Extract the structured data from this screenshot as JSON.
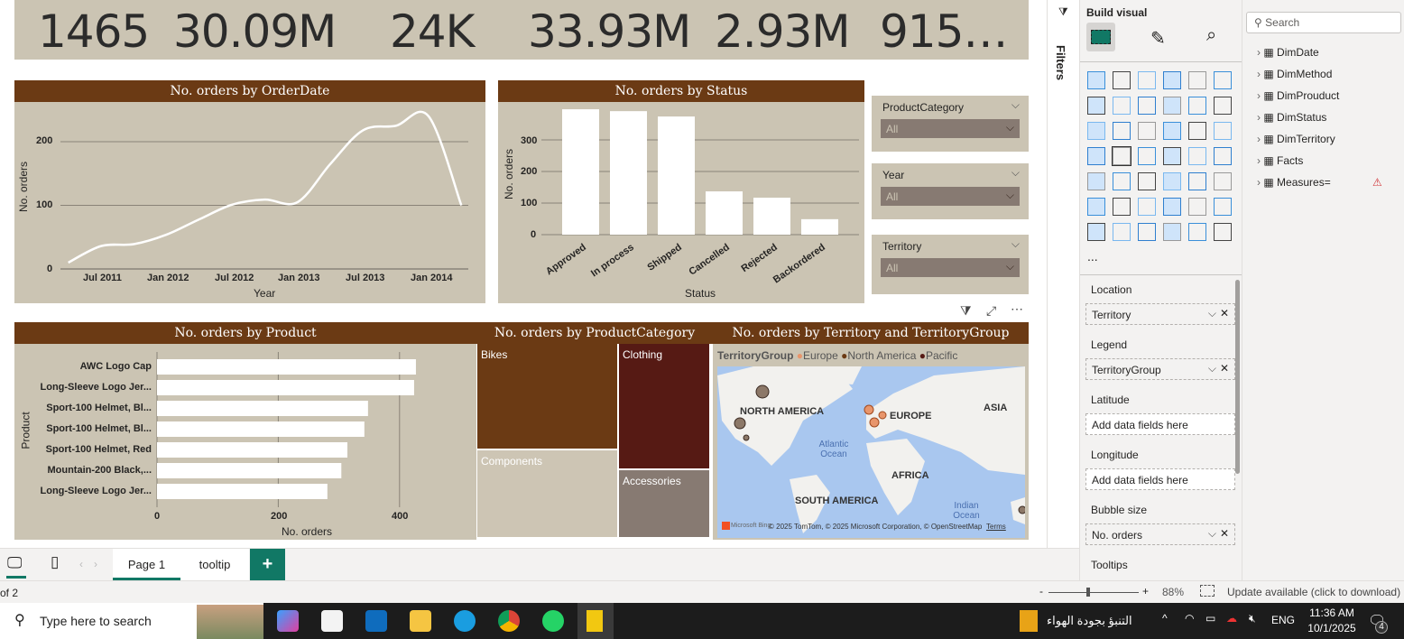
{
  "kpis": [
    "1465",
    "30.09M",
    "24K",
    "33.93M",
    "2.93M",
    "915…"
  ],
  "colors": {
    "header": "#6b3a14",
    "panel": "#cbc4b3",
    "bikes": "#6b3a14",
    "clothing": "#561a14",
    "components": "#cdc5b4",
    "accessories": "#877a72",
    "europe": "#e8956b",
    "north_america": "#6b3a14",
    "pacific": "#561a14",
    "accent": "#117865"
  },
  "line_chart": {
    "title": "No. orders by OrderDate",
    "xlabel": "Year",
    "ylabel": "No. orders",
    "yticks": [
      "0",
      "100",
      "200"
    ],
    "xticks": [
      "Jul 2011",
      "Jan 2012",
      "Jul 2012",
      "Jan 2013",
      "Jul 2013",
      "Jan 2014"
    ]
  },
  "status_chart": {
    "title": "No. orders by Status",
    "xlabel": "Status",
    "ylabel": "No. orders",
    "yticks": [
      "0",
      "100",
      "200",
      "300"
    ]
  },
  "product_chart": {
    "title": "No. orders by Product",
    "xlabel": "No. orders",
    "ylabel": "Product",
    "xticks": [
      "0",
      "200",
      "400"
    ]
  },
  "treemap": {
    "title": "No. orders by ProductCategory",
    "items": [
      "Bikes",
      "Clothing",
      "Components",
      "Accessories"
    ]
  },
  "map": {
    "title": "No. orders by Territory and TerritoryGroup",
    "legend_title": "TerritoryGroup",
    "legend": [
      "Europe",
      "North America",
      "Pacific"
    ],
    "labels": [
      "NORTH AMERICA",
      "EUROPE",
      "ASIA",
      "AFRICA",
      "SOUTH AMERICA",
      "Atlantic Ocean",
      "Indian Ocean"
    ],
    "attribution": "© 2025 TomTom, © 2025 Microsoft Corporation, © OpenStreetMap",
    "terms": "Terms",
    "bing": "Microsoft Bing"
  },
  "slicers": [
    {
      "title": "ProductCategory",
      "value": "All"
    },
    {
      "title": "Year",
      "value": "All"
    },
    {
      "title": "Territory",
      "value": "All"
    }
  ],
  "chart_data": [
    {
      "type": "line",
      "title": "No. orders by OrderDate",
      "xlabel": "Year",
      "ylabel": "No. orders",
      "x": [
        "Apr 2011",
        "Jul 2011",
        "Oct 2011",
        "Jan 2012",
        "Apr 2012",
        "Jul 2012",
        "Oct 2012",
        "Jan 2013",
        "Apr 2013",
        "Jul 2013",
        "Oct 2013",
        "Jan 2014",
        "Apr 2014"
      ],
      "x_month_index": [
        3,
        6,
        9,
        12,
        15,
        18,
        21,
        24,
        27,
        30,
        33,
        36,
        39
      ],
      "values": [
        10,
        36,
        39,
        54,
        78,
        101,
        109,
        105,
        165,
        218,
        225,
        240,
        100
      ],
      "ylim": [
        0,
        250
      ]
    },
    {
      "type": "bar",
      "title": "No. orders by Status",
      "categories": [
        "Approved",
        "In process",
        "Shipped",
        "Cancelled",
        "Rejected",
        "Backordered"
      ],
      "values": [
        397,
        391,
        374,
        137,
        117,
        49
      ],
      "ylim": [
        0,
        400
      ]
    },
    {
      "type": "bar",
      "orientation": "horizontal",
      "title": "No. orders by Product",
      "categories": [
        "AWC Logo Cap",
        "Long-Sleeve Logo Jer...",
        "Sport-100 Helmet, Bl...",
        "Sport-100 Helmet, Bl...",
        "Sport-100 Helmet, Red",
        "Mountain-200 Black,...",
        "Long-Sleeve Logo Jer..."
      ],
      "values": [
        427,
        424,
        348,
        342,
        314,
        304,
        281
      ],
      "xlim": [
        0,
        500
      ]
    }
  ],
  "filters_label": "Filters",
  "build": {
    "title": "Build visual",
    "more": "...",
    "icons": [
      "stacked-bar",
      "stacked-column",
      "clustered-bar",
      "clustered-column",
      "100-bar",
      "100-column",
      "line",
      "area",
      "stacked-area",
      "ribbon-area",
      "line-column",
      "line-clustered",
      "ribbon",
      "waterfall",
      "funnel",
      "scatter",
      "pie",
      "donut",
      "treemap",
      "map",
      "filled-map",
      "azure-map",
      "gauge",
      "card",
      "multirow-card",
      "kpi",
      "slicer",
      "table",
      "matrix",
      "r-visual",
      "python-visual",
      "key-influencers",
      "decomposition-tree",
      "qa",
      "paginated",
      "trophy",
      "report",
      "power-apps-card",
      "power-apps-slicer",
      "arcgis",
      "power-apps",
      "power-automate"
    ],
    "wells": [
      {
        "label": "Location",
        "value": "Territory"
      },
      {
        "label": "Legend",
        "value": "TerritoryGroup"
      },
      {
        "label": "Latitude",
        "value": "Add data fields here"
      },
      {
        "label": "Longitude",
        "value": "Add data fields here"
      },
      {
        "label": "Bubble size",
        "value": "No. orders"
      },
      {
        "label": "Tooltips",
        "value": ""
      }
    ]
  },
  "data_pane": {
    "search_placeholder": "Search",
    "tables": [
      "DimDate",
      "DimMethod",
      "DimProuduct",
      "DimStatus",
      "DimTerritory",
      "Facts",
      "Measures="
    ]
  },
  "tabs": [
    "Page 1",
    "tooltip"
  ],
  "status": {
    "page": "of 2",
    "zoom": "88%",
    "update": "Update available (click to download)",
    "minus": "-",
    "plus": "+"
  },
  "taskbar": {
    "search": "Type here to search",
    "weather": "التنبؤ بجودة الهواء",
    "lang": "ENG",
    "time": "11:36 AM",
    "date": "10/1/2025",
    "notif": "4"
  }
}
